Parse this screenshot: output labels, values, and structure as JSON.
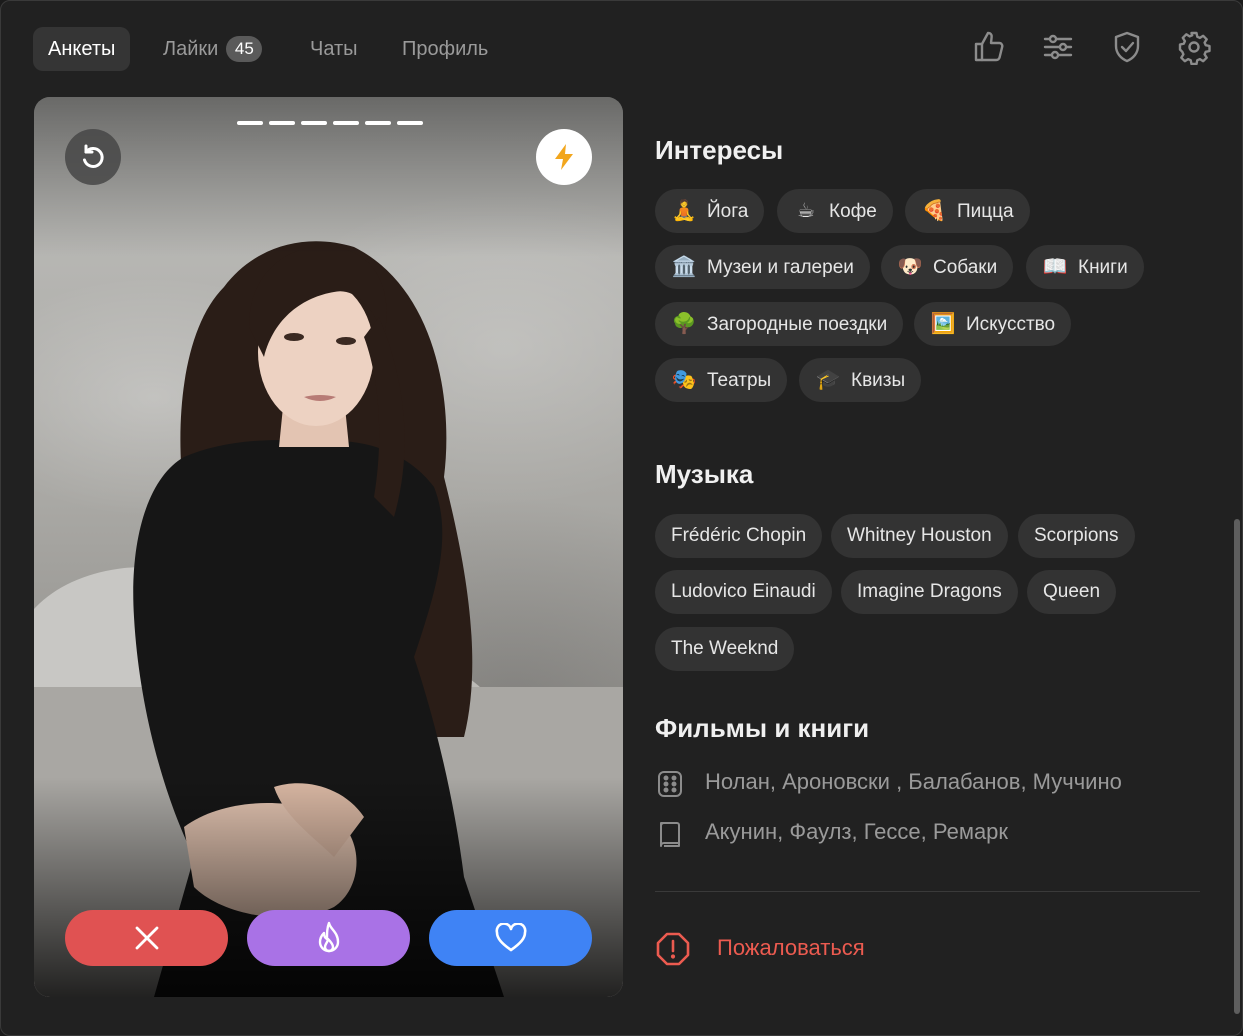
{
  "nav": {
    "tabs": [
      {
        "label": "Анкеты",
        "active": true
      },
      {
        "label": "Лайки",
        "badge": "45"
      },
      {
        "label": "Чаты"
      },
      {
        "label": "Профиль"
      }
    ],
    "icons": [
      "thumbs-up-icon",
      "sliders-icon",
      "shield-check-icon",
      "gear-icon"
    ]
  },
  "card": {
    "photo_count": 6,
    "icons": [
      "undo-icon",
      "lightning-icon"
    ],
    "actions": [
      "close-icon",
      "flame-icon",
      "heart-icon"
    ]
  },
  "interests": {
    "title": "Интересы",
    "items": [
      {
        "emoji": "🧘",
        "label": "Йога"
      },
      {
        "emoji": "☕",
        "label": "Кофе"
      },
      {
        "emoji": "🍕",
        "label": "Пицца"
      },
      {
        "emoji": "🏛️",
        "label": "Музеи и галереи"
      },
      {
        "emoji": "🐶",
        "label": "Собаки"
      },
      {
        "emoji": "📖",
        "label": "Книги"
      },
      {
        "emoji": "🌳",
        "label": "Загородные поездки"
      },
      {
        "emoji": "🖼️",
        "label": "Искусство"
      },
      {
        "emoji": "🎭",
        "label": "Театры"
      },
      {
        "emoji": "🎓",
        "label": "Квизы"
      }
    ]
  },
  "music": {
    "title": "Музыка",
    "items": [
      "Frédéric Chopin",
      "Whitney Houston",
      "Scorpions",
      "Ludovico Einaudi",
      "Imagine Dragons",
      "Queen",
      "The Weeknd"
    ]
  },
  "films_books": {
    "title": "Фильмы и книги",
    "films": "Нолан, Ароновски , Балабанов, Муччино",
    "books": "Акунин, Фаулз, Гессе, Ремарк"
  },
  "report_label": "Пожаловаться",
  "colors": {
    "dislike": "#e05252",
    "superlike": "#a972e6",
    "like": "#3f83f5",
    "report": "#ec5b50",
    "boost": "#f2a61d"
  }
}
